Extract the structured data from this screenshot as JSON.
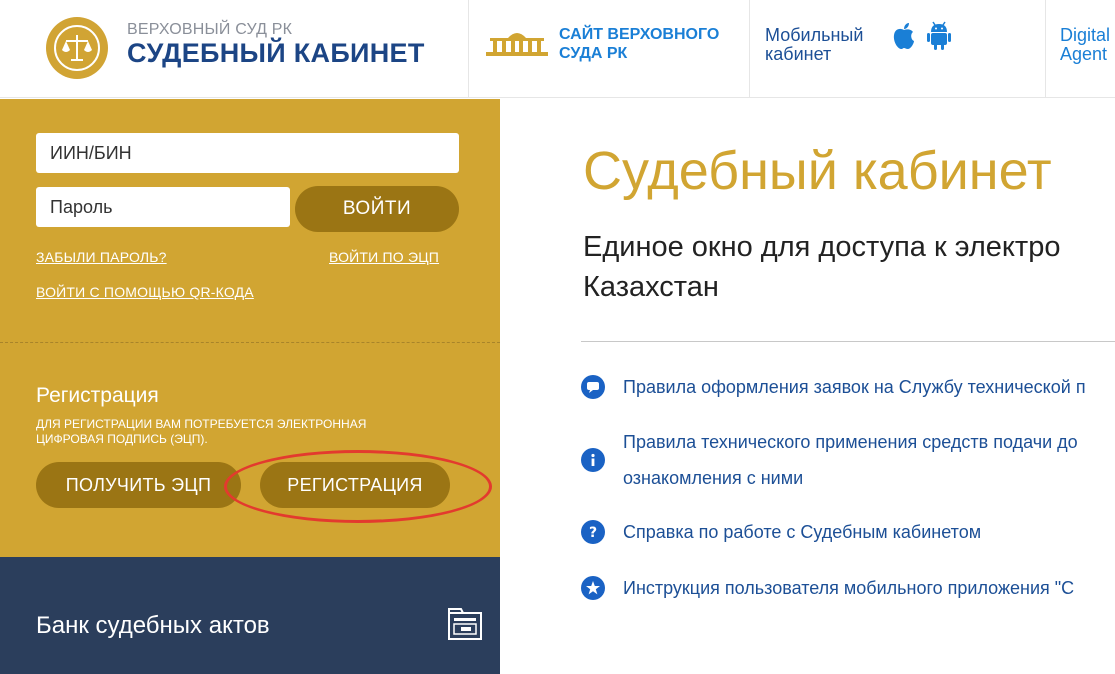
{
  "header": {
    "brand_sub": "ВЕРХОВНЫЙ СУД РК",
    "brand_title": "СУДЕБНЫЙ КАБИНЕТ",
    "court_link": [
      "САЙТ ВЕРХОВНОГО",
      "СУДА РК"
    ],
    "mobile_link": [
      "Мобильный",
      "кабинет"
    ],
    "digital_link": [
      "Digital",
      "Agent"
    ]
  },
  "login": {
    "iin_placeholder": "ИИН/БИН",
    "password_placeholder": "Пароль",
    "submit_label": "ВОЙТИ",
    "forgot_link": "ЗАБЫЛИ ПАРОЛЬ?",
    "ecp_link": "ВОЙТИ ПО ЭЦП",
    "qr_link": "ВОЙТИ С ПОМОЩЬЮ QR-КОДА"
  },
  "registration": {
    "title": "Регистрация",
    "description": "ДЛЯ РЕГИСТРАЦИИ ВАМ ПОТРЕБУЕТСЯ ЭЛЕКТРОННАЯ ЦИФРОВАЯ ПОДПИСЬ (ЭЦП).",
    "get_ecp_label": "ПОЛУЧИТЬ ЭЦП",
    "register_label": "РЕГИСТРАЦИЯ"
  },
  "bank": {
    "label": "Банк судебных актов"
  },
  "main": {
    "title": "Судебный кабинет",
    "subtitle": [
      "Единое окно для доступа к электро",
      "Казахстан"
    ],
    "links": [
      {
        "icon": "chat-icon",
        "lines": [
          "Правила оформления заявок на Службу технической п"
        ]
      },
      {
        "icon": "info-icon",
        "lines": [
          "Правила технического применения средств подачи до",
          "ознакомления с ними"
        ]
      },
      {
        "icon": "question-icon",
        "lines": [
          "Справка по работе с Судебным кабинетом"
        ]
      },
      {
        "icon": "star-icon",
        "lines": [
          "Инструкция пользователя мобильного приложения \"С"
        ]
      }
    ]
  },
  "colors": {
    "gold": "#d1a532",
    "gold_dark": "#9b7514",
    "navy": "#2b3e5c",
    "brand_blue": "#1c4585",
    "link_blue": "#1a7fd6",
    "annotation_red": "#e33a2e"
  }
}
